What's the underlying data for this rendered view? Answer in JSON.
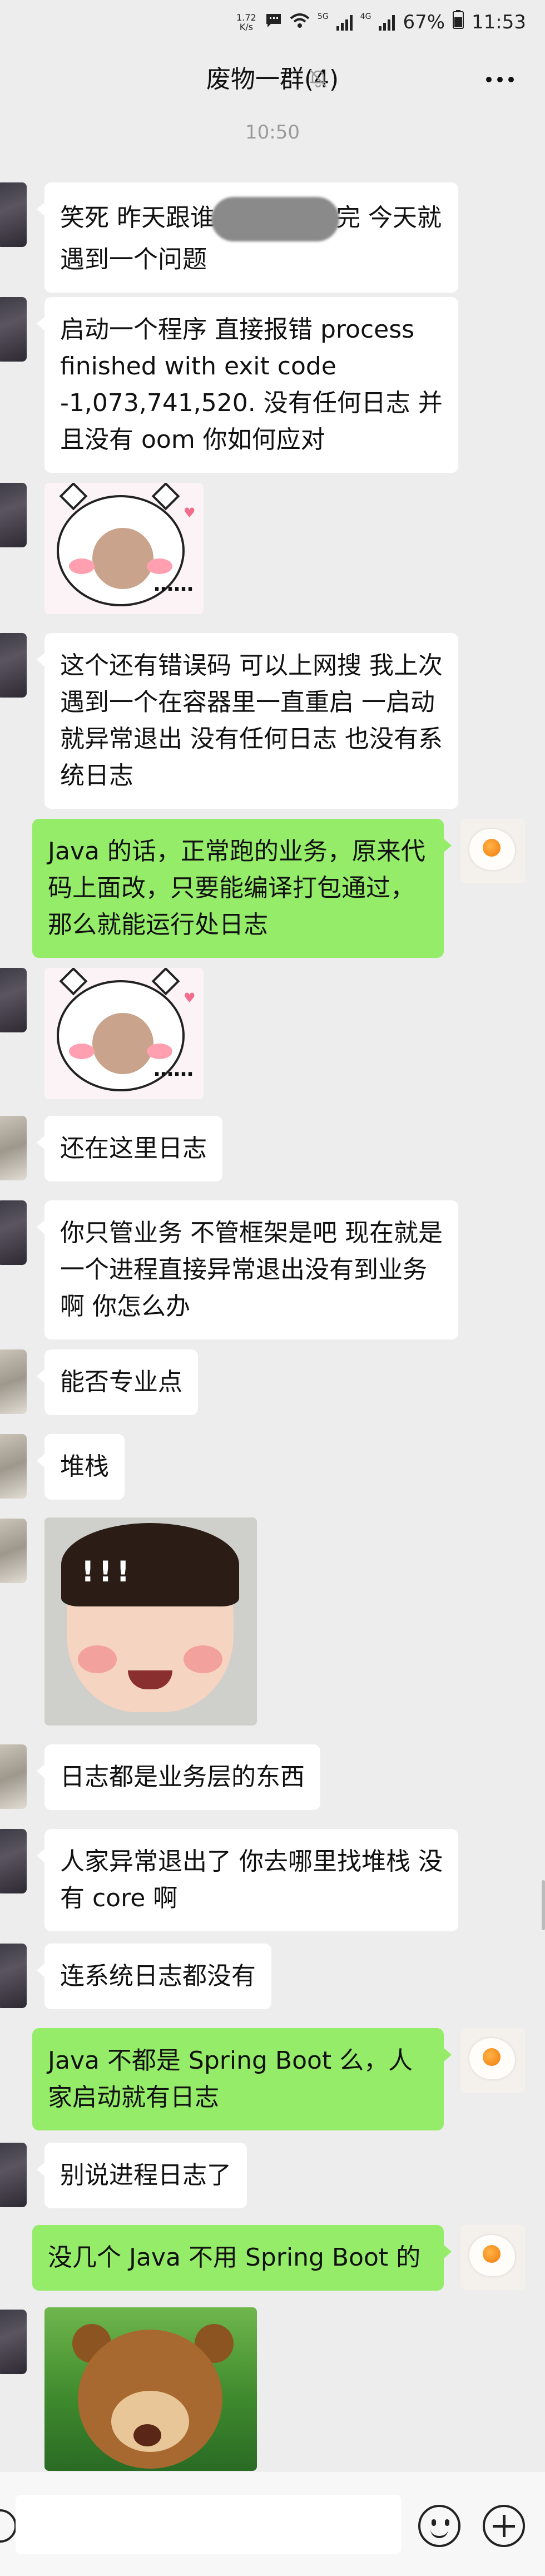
{
  "status_bar": {
    "speed_value": "1.72",
    "speed_unit": "K/s",
    "net_5g": "5G",
    "net_4g": "4G",
    "battery": "67%",
    "time": "11:53"
  },
  "header": {
    "title": "废物一群(4)"
  },
  "timestamp": "10:50",
  "messages": [
    {
      "text_pre": "笑死 昨天跟谁",
      "text_post": "完 今天就遇到一个问题"
    },
    {
      "text": "启动一个程序 直接报错 process finished with exit code -1,073,741,520. 没有任何日志 并且没有 oom 你如何应对"
    },
    {
      "sticker_text": "……"
    },
    {
      "text": "这个还有错误码 可以上网搜 我上次遇到一个在容器里一直重启 一启动就异常退出 没有任何日志 也没有系统日志"
    },
    {
      "text": "Java 的话，正常跑的业务，原来代码上面改，只要能编译打包通过，那么就能运行处日志"
    },
    {
      "sticker_text": "……"
    },
    {
      "text": "还在这里日志"
    },
    {
      "text": "你只管业务 不管框架是吧 现在就是一个进程直接异常退出没有到业务啊 你怎么办"
    },
    {
      "text": "能否专业点"
    },
    {
      "text": "堆栈"
    },
    {
      "sticker_text": "!!!"
    },
    {
      "text": "日志都是业务层的东西"
    },
    {
      "text": "人家异常退出了 你去哪里找堆栈 没有 core 啊"
    },
    {
      "text": "连系统日志都没有"
    },
    {
      "text": "Java 不都是 Spring Boot 么，人家启动就有日志"
    },
    {
      "text": "别说进程日志了"
    },
    {
      "text": "没几个 Java 不用 Spring Boot 的"
    }
  ]
}
